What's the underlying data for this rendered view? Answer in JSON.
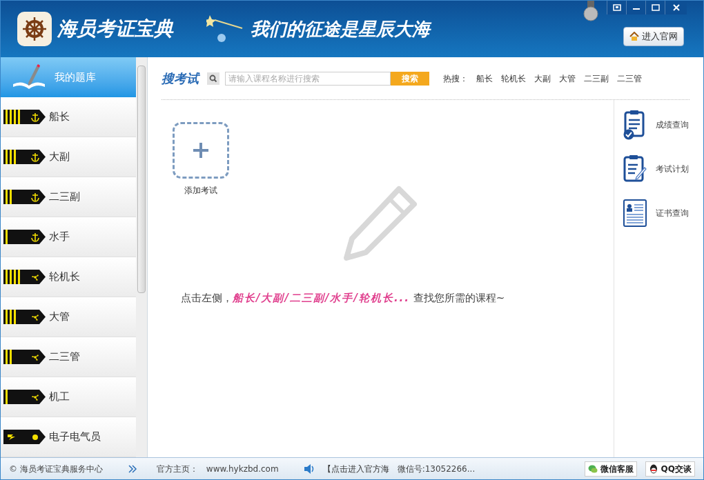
{
  "header": {
    "app_title": "海员考证宝典",
    "slogan": "我们的征途是星辰大海",
    "website_button": "进入官网"
  },
  "sidebar": {
    "header": {
      "label": "我的题库",
      "selected": true
    },
    "items": [
      {
        "label": "船长",
        "kind": "captain",
        "selected": false
      },
      {
        "label": "大副",
        "kind": "mate",
        "selected": false
      },
      {
        "label": "二三副",
        "kind": "officer",
        "selected": false
      },
      {
        "label": "水手",
        "kind": "sailor",
        "selected": false
      },
      {
        "label": "轮机长",
        "kind": "chiefengineer",
        "selected": false
      },
      {
        "label": "大管",
        "kind": "engineer",
        "selected": false
      },
      {
        "label": "二三管",
        "kind": "junior",
        "selected": false
      },
      {
        "label": "机工",
        "kind": "motorman",
        "selected": false
      },
      {
        "label": "电子电气员",
        "kind": "electrician",
        "selected": false
      }
    ]
  },
  "search": {
    "title": "搜考试",
    "placeholder": "请输入课程名称进行搜索",
    "button": "搜索",
    "hot_label": "热搜：",
    "hot_terms": [
      "船长",
      "轮机长",
      "大副",
      "大管",
      "二三副",
      "二三管"
    ]
  },
  "add_exam": {
    "label": "添加考试"
  },
  "hint": {
    "before": "点击左侧，",
    "highlight": "船长/大副/二三副/水手/轮机长...",
    "after": "查找您所需的课程~"
  },
  "right_panel": [
    {
      "label": "成绩查询",
      "kind": "score"
    },
    {
      "label": "考试计划",
      "kind": "plan"
    },
    {
      "label": "证书查询",
      "kind": "certificate"
    }
  ],
  "status_bar": {
    "copyright": "© 海员考证宝典服务中心",
    "homepage_label": "官方主页：",
    "homepage_url": "www.hykzbd.com",
    "notice": "【点击进入官方海",
    "wechat_id": "微信号:13052266...",
    "wechat_button": "微信客服",
    "qq_button": "QQ交谈"
  }
}
